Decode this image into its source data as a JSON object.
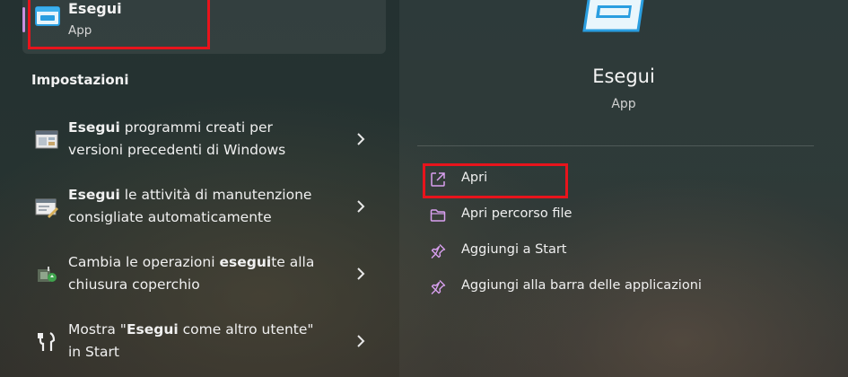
{
  "best_match": {
    "title": "Esegui",
    "subtitle": "App",
    "icon": "run-dialog-icon"
  },
  "settings": {
    "heading": "Impostazioni",
    "items": [
      {
        "bold": "Esegui",
        "rest": " programmi creati per",
        "line2": "versioni precedenti di Windows",
        "icon": "compatibility-icon"
      },
      {
        "bold": "Esegui",
        "rest": " le attività di manutenzione",
        "line2": "consigliate automaticamente",
        "icon": "maintenance-icon"
      },
      {
        "pre": "Cambia le operazioni ",
        "bold": "esegui",
        "rest": "te alla",
        "line2": "chiusura coperchio",
        "icon": "power-options-icon"
      },
      {
        "pre": "Mostra \"",
        "bold": "Esegui",
        "rest": " come altro utente\"",
        "line2": "in Start",
        "icon": "run-as-user-icon"
      }
    ]
  },
  "details": {
    "title": "Esegui",
    "subtitle": "App",
    "actions": [
      {
        "label": "Apri",
        "icon": "open-external-icon"
      },
      {
        "label": "Apri percorso file",
        "icon": "folder-icon"
      },
      {
        "label": "Aggiungi a Start",
        "icon": "pin-icon"
      },
      {
        "label": "Aggiungi alla barra delle applicazioni",
        "icon": "pin-icon"
      }
    ]
  },
  "colors": {
    "highlight": "#e8141c",
    "accent_bar": "#c98fe0",
    "action_icon": "#d9a0f0",
    "app_icon_blue": "#33a8e8"
  }
}
